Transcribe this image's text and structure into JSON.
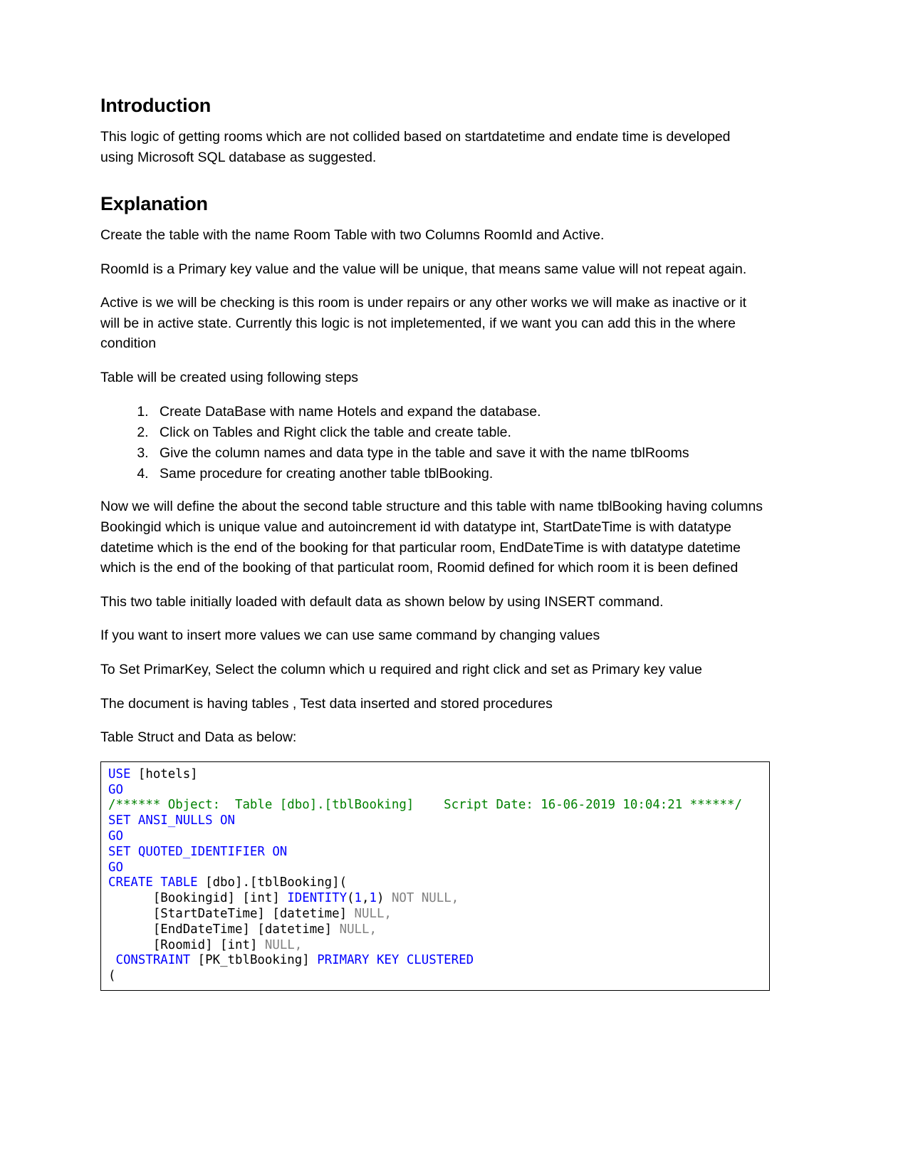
{
  "document": {
    "sections": [
      {
        "heading": "Introduction",
        "paragraphs": [
          "This logic of getting rooms which are not collided based on startdatetime and endate time is developed using Microsoft SQL database as suggested."
        ]
      },
      {
        "heading": "Explanation",
        "paragraphs": [
          "Create the table with the name Room Table with two Columns RoomId and Active.",
          "RoomId is a Primary key value and the value will be unique, that means same value will not repeat again.",
          "Active is we will be checking is this room is under repairs or any other works we will make as inactive or it will be in active state. Currently this logic is not impletemented, if we want you can add this in the where condition",
          "Table will be created using following steps"
        ]
      }
    ],
    "steps": [
      "Create DataBase with name Hotels and expand the database.",
      "Click on Tables and Right click the table and create table.",
      "Give the column names and data type in the table and save it with the name tblRooms",
      "Same procedure for creating another table tblBooking."
    ],
    "closing_paragraphs": [
      "Now we will define the about the second table structure and this table with name tblBooking having columns Bookingid which is unique value and autoincrement id with datatype int, StartDateTime is with datatype datetime which is the end of the booking for that particular room, EndDateTime is with datatype datetime which is the end of the booking of that particulat room, Roomid defined for which room it is been defined",
      "This two table initially loaded with default data as shown below by using INSERT command.",
      "If you want to insert more values we can use same command by changing values",
      "To Set PrimarKey, Select the column which u required and right click and set as Primary key value",
      "The document is having tables , Test data inserted and stored procedures",
      "Table Struct and Data as below:"
    ],
    "code_block": {
      "language": "sql",
      "script_date": "16-06-2019 10:04:21",
      "lines": [
        [
          {
            "t": "USE",
            "c": "kw"
          },
          {
            "t": " [hotels]",
            "c": "pln"
          }
        ],
        [
          {
            "t": "GO",
            "c": "kw"
          }
        ],
        [
          {
            "t": "/****** Object:  Table [dbo].[tblBooking]    Script Date: 16-06-2019 10:04:21 ******/",
            "c": "cmt"
          }
        ],
        [
          {
            "t": "SET ANSI_NULLS ON",
            "c": "kw"
          }
        ],
        [
          {
            "t": "GO",
            "c": "kw"
          }
        ],
        [
          {
            "t": "SET QUOTED_IDENTIFIER ON",
            "c": "kw"
          }
        ],
        [
          {
            "t": "GO",
            "c": "kw"
          }
        ],
        [
          {
            "t": "CREATE TABLE",
            "c": "kw"
          },
          {
            "t": " [dbo].[tblBooking](",
            "c": "pln"
          }
        ],
        [
          {
            "t": "      [Bookingid] [int] ",
            "c": "pln"
          },
          {
            "t": "IDENTITY",
            "c": "kw"
          },
          {
            "t": "(",
            "c": "pln"
          },
          {
            "t": "1",
            "c": "kw"
          },
          {
            "t": ",",
            "c": "pln"
          },
          {
            "t": "1",
            "c": "kw"
          },
          {
            "t": ")",
            "c": "pln"
          },
          {
            "t": " NOT NULL,",
            "c": "nul"
          }
        ],
        [
          {
            "t": "      [StartDateTime] [datetime] ",
            "c": "pln"
          },
          {
            "t": "NULL,",
            "c": "nul"
          }
        ],
        [
          {
            "t": "      [EndDateTime] [datetime] ",
            "c": "pln"
          },
          {
            "t": "NULL,",
            "c": "nul"
          }
        ],
        [
          {
            "t": "      [Roomid] [int] ",
            "c": "pln"
          },
          {
            "t": "NULL,",
            "c": "nul"
          }
        ],
        [
          {
            "t": " ",
            "c": "pln"
          },
          {
            "t": "CONSTRAINT",
            "c": "kw"
          },
          {
            "t": " [PK_tblBooking] ",
            "c": "pln"
          },
          {
            "t": "PRIMARY KEY CLUSTERED",
            "c": "kw"
          }
        ],
        [
          {
            "t": "(",
            "c": "pln"
          }
        ]
      ]
    }
  },
  "colors": {
    "keyword": "#0000ff",
    "comment": "#008000",
    "null_literal": "#808080",
    "plain": "#000000",
    "page_background": "#ffffff",
    "border": "#000000"
  }
}
